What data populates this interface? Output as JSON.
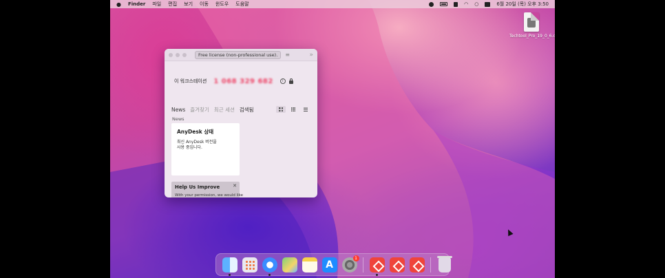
{
  "menubar": {
    "app_name": "Finder",
    "menus": [
      "파일",
      "편집",
      "보기",
      "이동",
      "윈도우",
      "도움말"
    ],
    "datetime": "6월 20일 (목) 오후 3:50"
  },
  "desktop": {
    "file_name": "Techtool_Pro_19_0_6.dmg"
  },
  "anydesk": {
    "license_badge": "Free license (non-professional use).",
    "workstation_label": "이 워크스테이션",
    "workstation_id": "1 068 329 682",
    "tabs": {
      "news": "News",
      "favorites": "즐겨찾기",
      "recent": "최근 세션",
      "searched": "검색됨"
    },
    "section_label": "News",
    "status_card": {
      "title": "AnyDesk 상태",
      "body": "최신 AnyDesk 버전을 사용 중입니다."
    },
    "improve_card": {
      "title": "Help Us Improve",
      "body": "With your permission, we would like"
    }
  },
  "dock": {
    "items": [
      "finder",
      "launchpad",
      "safari",
      "maps",
      "notes",
      "app-store",
      "system-settings",
      "anydesk",
      "anydesk",
      "anydesk",
      "trash"
    ],
    "settings_badge": "1"
  }
}
